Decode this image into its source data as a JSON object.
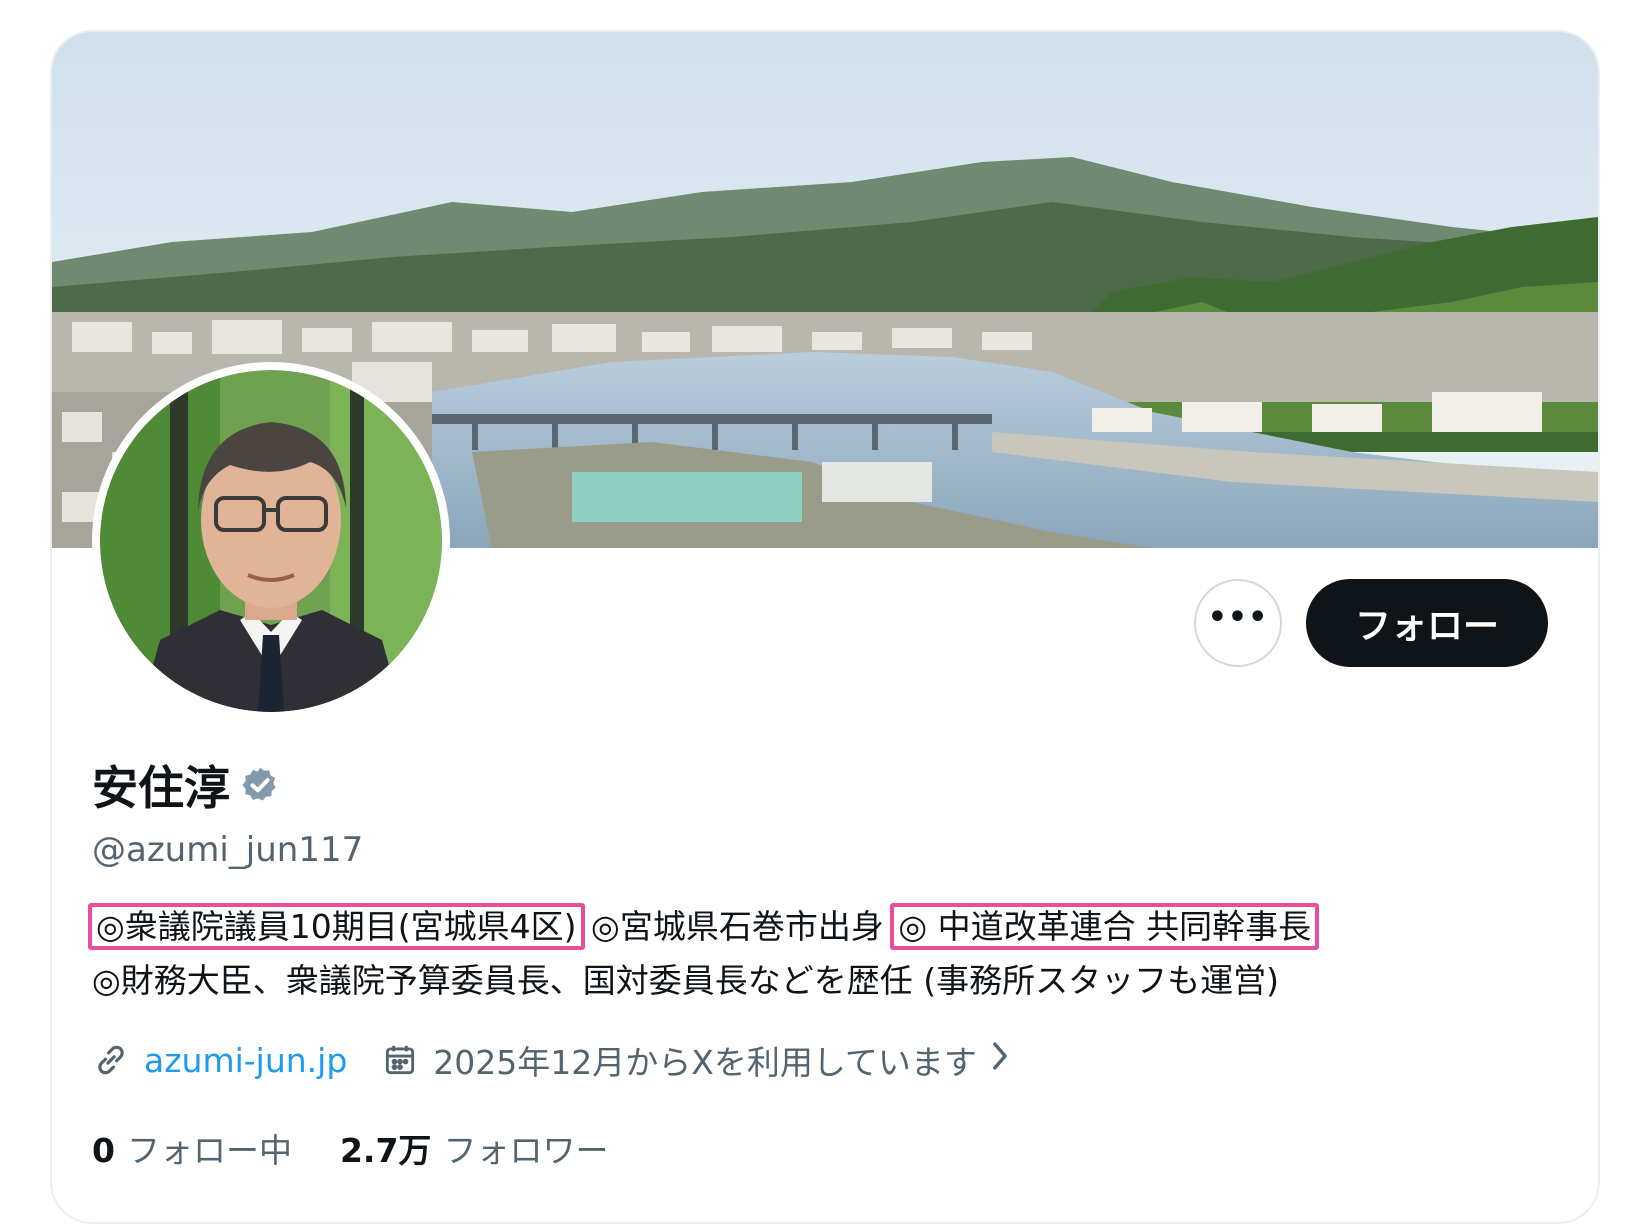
{
  "profile": {
    "display_name": "安住淳",
    "handle": "@azumi_jun117",
    "verified": true,
    "bio": {
      "line1": {
        "part1": "◎衆議院議員10期目(宮城県4区)",
        "part2": "◎宮城県石巻市出身",
        "part3": "◎ 中道改革連合 共同幹事長"
      },
      "line2": "◎財務大臣、衆議院予算委員長、国対委員長などを歴任 (事務所スタッフも運営)"
    },
    "website": "azumi-jun.jp",
    "joined": "2025年12月からXを利用しています",
    "stats": {
      "following_count": "0",
      "following_label": "フォロー中",
      "followers_count": "2.7万",
      "followers_label": "フォロワー"
    }
  },
  "actions": {
    "more_label": "•••",
    "follow_label": "フォロー"
  },
  "colors": {
    "highlight_border": "#e94e9b",
    "link": "#1d9bf0",
    "follow_bg": "#0f1419",
    "verified_badge": "#829aab"
  },
  "icons": {
    "verified": "verified-badge-icon",
    "website": "link-icon",
    "joined": "calendar-icon",
    "chevron": "chevron-right-icon",
    "more": "more-dots-icon"
  }
}
